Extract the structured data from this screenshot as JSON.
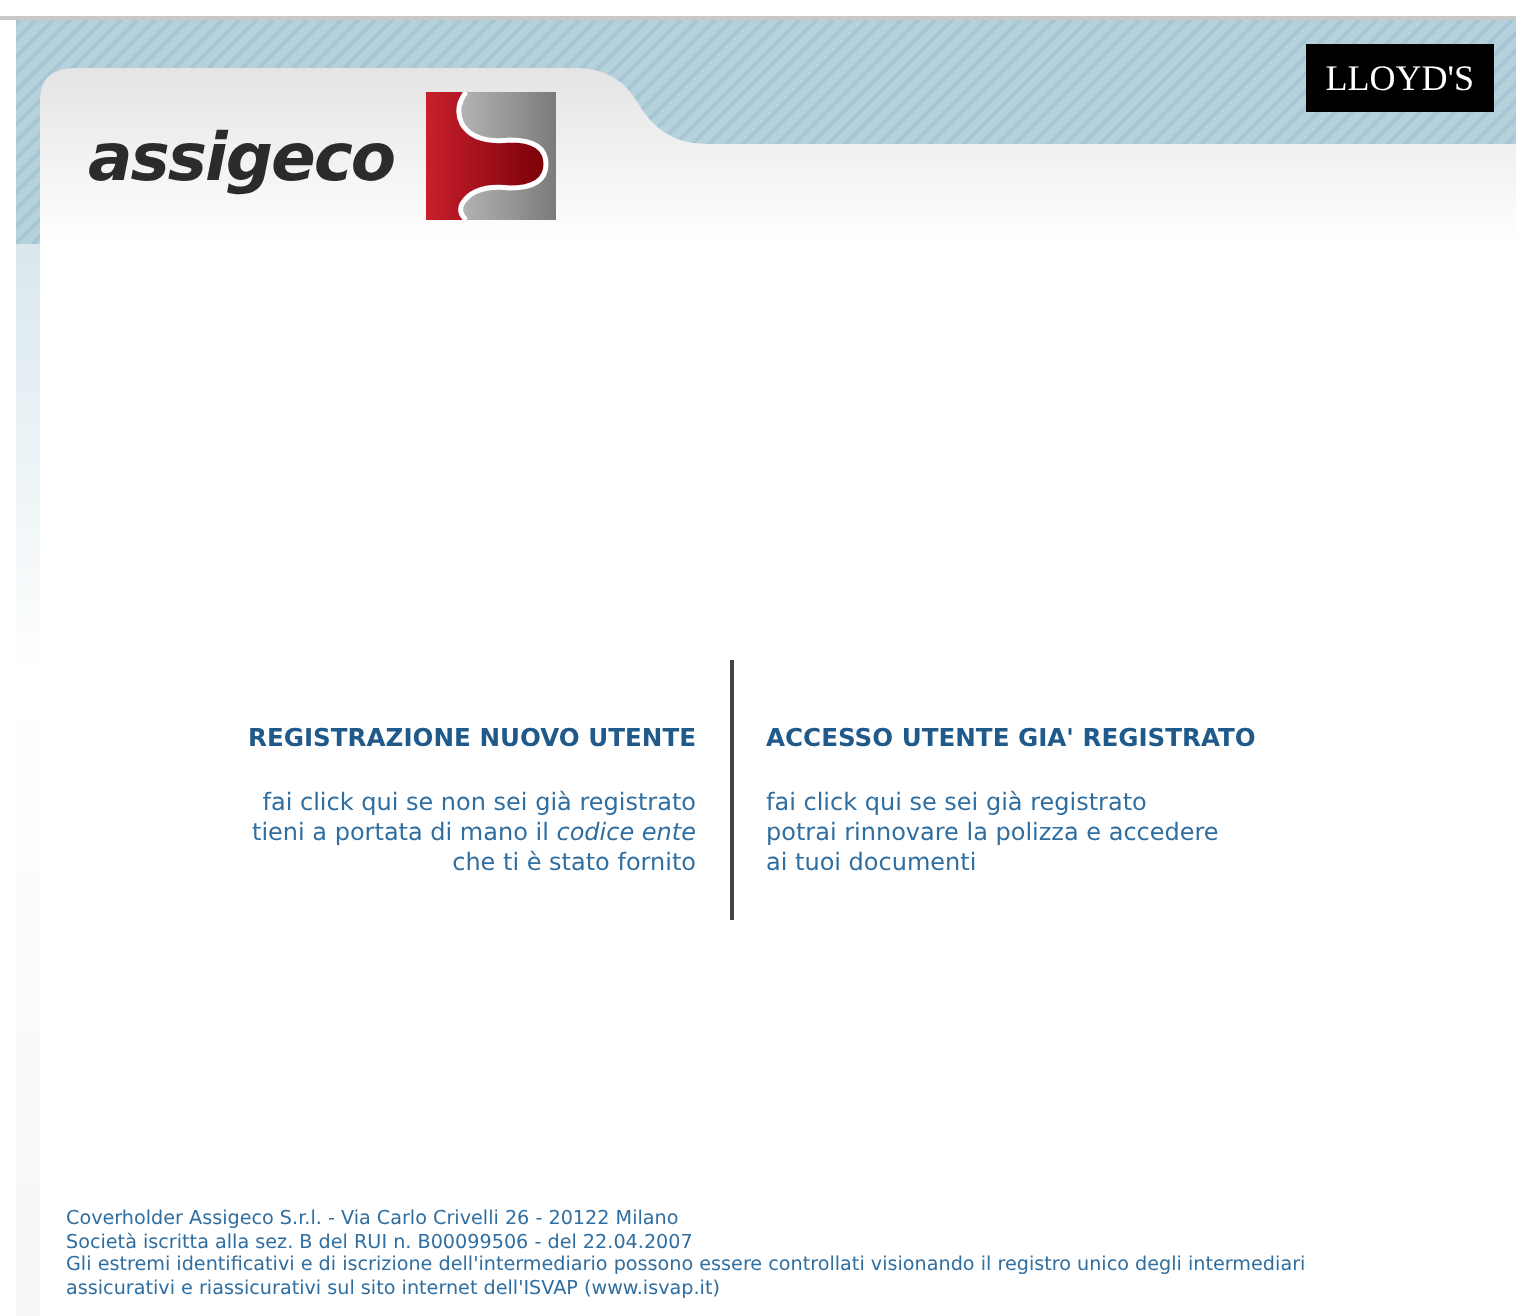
{
  "header": {
    "logo_text": "assigeco",
    "partner_badge": "LLOYD'S"
  },
  "panels": [
    {
      "title": "REGISTRAZIONE NUOVO UTENTE",
      "lines": [
        "fai click qui se non sei già registrato",
        "tieni a portata di mano il *codice ente*",
        "che ti è stato fornito"
      ]
    },
    {
      "title": "ACCESSO UTENTE GIA' REGISTRATO",
      "lines": [
        "fai click qui se sei già registrato",
        "potrai rinnovare la polizza e accedere",
        "ai tuoi documenti"
      ]
    }
  ],
  "footer": {
    "address": "Coverholder Assigeco S.r.l. - Via Carlo Crivelli 26 - 20122 Milano",
    "registration": "Società iscritta alla sez. B del RUI n. B00099506 - del 22.04.2007",
    "notice": [
      "Gli estremi identificativi e di iscrizione dell'intermediario possono essere controllati visionando il registro unico degli intermediari",
      "assicurativi e riassicurativi sul sito internet dell'ISVAP (www.isvap.it)"
    ]
  }
}
